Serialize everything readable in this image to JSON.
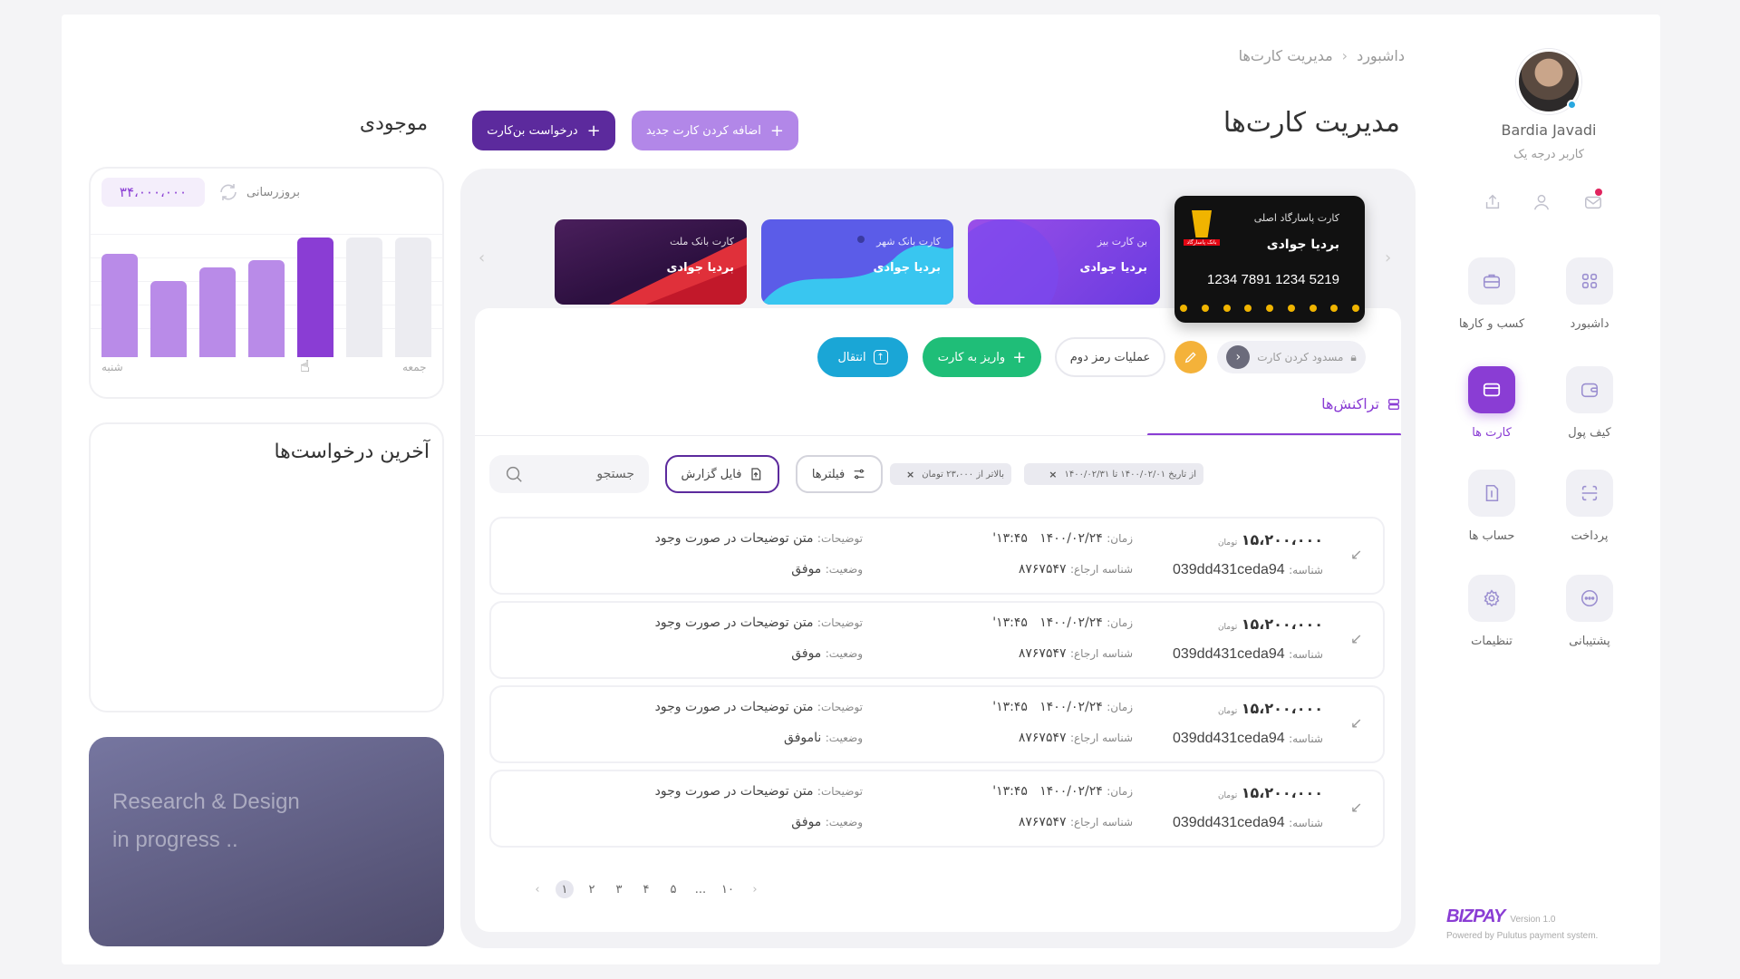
{
  "breadcrumb": {
    "home": "داشبورد",
    "current": "مدیریت کارت‌ها"
  },
  "header": {
    "title": "مدیریت کارت‌ها",
    "add_card": "اضافه کردن کارت جدید",
    "request_card": "درخواست بن‌کارت"
  },
  "user": {
    "name": "Bardia Javadi",
    "role": "کاربر درجه یک"
  },
  "nav": [
    {
      "label": "داشبورد",
      "icon": "grid-icon",
      "active": false
    },
    {
      "label": "کسب و کارها",
      "icon": "briefcase-icon",
      "active": false
    },
    {
      "label": "کیف پول",
      "icon": "wallet-icon",
      "active": false
    },
    {
      "label": "کارت ها",
      "icon": "card-icon",
      "active": true
    },
    {
      "label": "پرداخت",
      "icon": "scan-icon",
      "active": false
    },
    {
      "label": "حساب ها",
      "icon": "invoice-icon",
      "active": false
    },
    {
      "label": "پشتیبانی",
      "icon": "chat-icon",
      "active": false
    },
    {
      "label": "تنظیمات",
      "icon": "gear-icon",
      "active": false
    }
  ],
  "brand": {
    "logo": "BIZPAY",
    "version": "Version 1.0",
    "powered": "Powered by Pulutus payment system."
  },
  "balance": {
    "title": "موجودی",
    "amount": "۳۴،۰۰۰،۰۰۰",
    "refresh": "بروزرسانی",
    "day_first": "شنبه",
    "day_last": "جمعه",
    "bars": [
      0.86,
      0.64,
      0.75,
      0.81,
      1.0,
      1.0,
      1.0
    ],
    "bar_colors": [
      "#b98be8",
      "#b98be8",
      "#b98be8",
      "#b98be8",
      "#8a3dd4",
      "#ececf1",
      "#ececf1"
    ]
  },
  "requests": {
    "title": "آخرین درخواست‌ها"
  },
  "progress": {
    "line1": "Research & Design",
    "line2": "in progress .."
  },
  "cards": [
    {
      "title": "کارت پاسارگاد اصلی",
      "name": "بردیا جوادی",
      "number": "1234 7891 1234 5219",
      "bank_logo_text": "بانک پاسارگاد"
    },
    {
      "title": "بن کارت بیز",
      "name": "بردیا جوادی"
    },
    {
      "title": "کارت بانک شهر",
      "name": "بردیا جوادی"
    },
    {
      "title": "کارت بانک ملت",
      "name": "بردیا جوادی"
    }
  ],
  "card_actions": {
    "block": "مسدود کردن کارت",
    "second_pass": "عملیات رمز دوم",
    "deposit": "واریز به کارت",
    "transfer": "انتقال"
  },
  "transactions": {
    "tab": "تراکنش‌ها",
    "search_placeholder": "جستجو",
    "report": "فایل گزارش",
    "filters": "فیلترها",
    "chip_date": "از تاریخ ۱۴۰۰/۰۲/۰۱ تا ۱۴۰۰/۰۲/۳۱",
    "chip_amount": "بالاتر از ۲۳،۰۰۰ تومان",
    "labels": {
      "amount_unit": "تومان",
      "time": "زمان:",
      "desc": "توضیحات:",
      "id": "شناسه:",
      "ref": "شناسه ارجاع:",
      "status": "وضعیت:"
    },
    "rows": [
      {
        "amount": "۱۵،۲۰۰،۰۰۰",
        "time": "۱۴۰۰/۰۲/۲۴   ۱۳:۴۵'",
        "desc": "متن توضیحات در صورت وجود",
        "id": "039dd431ceda94",
        "ref": "۸۷۶۷۵۴۷",
        "status": "موفق"
      },
      {
        "amount": "۱۵،۲۰۰،۰۰۰",
        "time": "۱۴۰۰/۰۲/۲۴   ۱۳:۴۵'",
        "desc": "متن توضیحات در صورت وجود",
        "id": "039dd431ceda94",
        "ref": "۸۷۶۷۵۴۷",
        "status": "موفق"
      },
      {
        "amount": "۱۵،۲۰۰،۰۰۰",
        "time": "۱۴۰۰/۰۲/۲۴   ۱۳:۴۵'",
        "desc": "متن توضیحات در صورت وجود",
        "id": "039dd431ceda94",
        "ref": "۸۷۶۷۵۴۷",
        "status": "ناموفق"
      },
      {
        "amount": "۱۵،۲۰۰،۰۰۰",
        "time": "۱۴۰۰/۰۲/۲۴   ۱۳:۴۵'",
        "desc": "متن توضیحات در صورت وجود",
        "id": "039dd431ceda94",
        "ref": "۸۷۶۷۵۴۷",
        "status": "موفق"
      }
    ]
  },
  "pagination": {
    "pages": [
      "۱",
      "۲",
      "۳",
      "۴",
      "۵",
      "...",
      "۱۰"
    ],
    "current": "۱"
  }
}
